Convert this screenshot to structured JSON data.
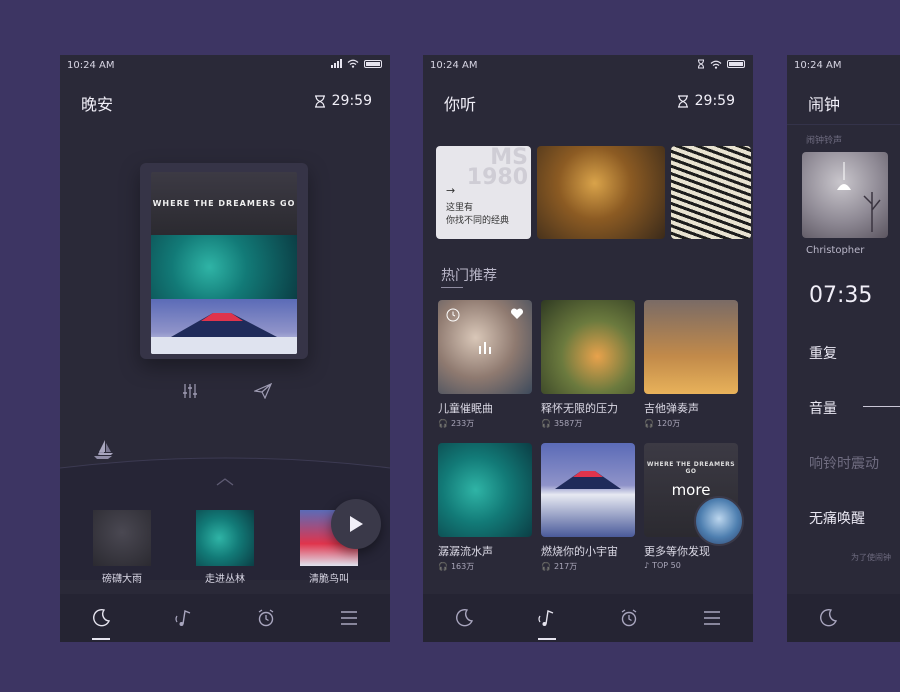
{
  "status_time": "10:24 AM",
  "phone1": {
    "title": "晚安",
    "timer": "29:59",
    "album_caption": "WHERE THE DREAMERS GO",
    "mini": [
      {
        "label": "磅礴大雨"
      },
      {
        "label": "走进丛林"
      },
      {
        "label": "清脆鸟叫"
      }
    ]
  },
  "phone2": {
    "title": "你听",
    "timer": "29:59",
    "banner1": {
      "big": "MS 1980",
      "arrow": "→",
      "line1": "这里有",
      "line2": "你找不同的经典"
    },
    "section_title": "热门推荐",
    "cards": [
      {
        "name": "儿童催眠曲",
        "count": "233万"
      },
      {
        "name": "释怀无限的压力",
        "count": "3587万"
      },
      {
        "name": "吉他弹奏声",
        "count": "120万"
      },
      {
        "name": "潺潺流水声",
        "count": "163万"
      },
      {
        "name": "燃烧你的小宇宙",
        "count": "217万"
      },
      {
        "name": "更多等你发现",
        "count": "TOP 50"
      }
    ],
    "more_caption": "WHERE THE DREAMERS GO",
    "more_label": "more"
  },
  "phone3": {
    "title": "闹钟",
    "subtitle": "闹钟铃声",
    "ringtone": "Christopher",
    "alarm_time": "07:35",
    "options": [
      "重复",
      "音量",
      "响铃时震动",
      "无痛唤醒"
    ],
    "footer": "为了使闹钟"
  },
  "colors": {
    "background": "#3d3563",
    "phone": "#2a2938",
    "tabbar": "#252433"
  }
}
